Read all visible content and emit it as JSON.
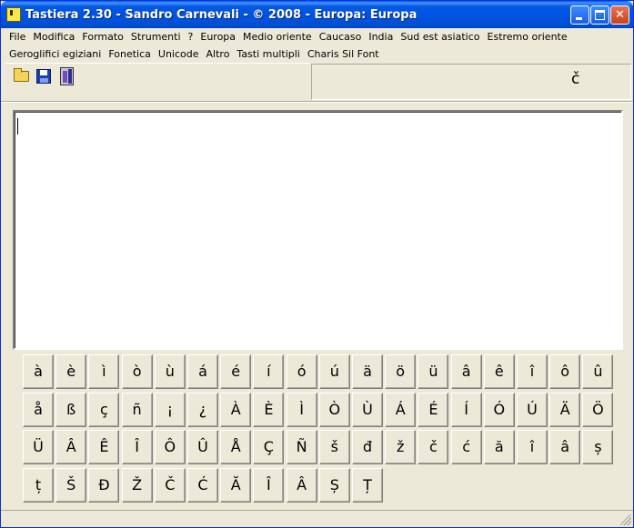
{
  "window": {
    "title": "Tastiera 2.30 - Sandro Carnevali - ©  2008 - Europa: Europa",
    "title_bar_color": "#0054E3",
    "close_button_color": "#C9401D"
  },
  "menubar_row1": [
    "File",
    "Modifica",
    "Formato",
    "Strumenti",
    "?",
    "Europa",
    "Medio oriente",
    "Caucaso",
    "India",
    "Sud est asiatico",
    "Estremo oriente"
  ],
  "menubar_row2": [
    "Geroglifici egiziani",
    "Fonetica",
    "Unicode",
    "Altro",
    "Tasti multipli",
    "Charis Sil Font"
  ],
  "toolbar": {
    "icons": [
      "open-folder-icon",
      "save-disk-icon",
      "exit-door-icon"
    ]
  },
  "preview": {
    "char": "č"
  },
  "editor": {
    "value": ""
  },
  "keys": [
    [
      "à",
      "è",
      "ì",
      "ò",
      "ù",
      "á",
      "é",
      "í",
      "ó",
      "ú",
      "ä",
      "ö",
      "ü",
      "â",
      "ê",
      "î",
      "ô",
      "û"
    ],
    [
      "å",
      "ß",
      "ç",
      "ñ",
      "¡",
      "¿",
      "À",
      "È",
      "Ì",
      "Ò",
      "Ù",
      "Á",
      "É",
      "Í",
      "Ó",
      "Ú",
      "Ä",
      "Ö"
    ],
    [
      "Ü",
      "Â",
      "Ê",
      "Î",
      "Ô",
      "Û",
      "Å",
      "Ç",
      "Ñ",
      "š",
      "đ",
      "ž",
      "č",
      "ć",
      "ă",
      "î",
      "â",
      "ș"
    ],
    [
      "ț",
      "Š",
      "Đ",
      "Ž",
      "Č",
      "Ć",
      "Ă",
      "Î",
      "Â",
      "Ș",
      "Ț"
    ]
  ]
}
